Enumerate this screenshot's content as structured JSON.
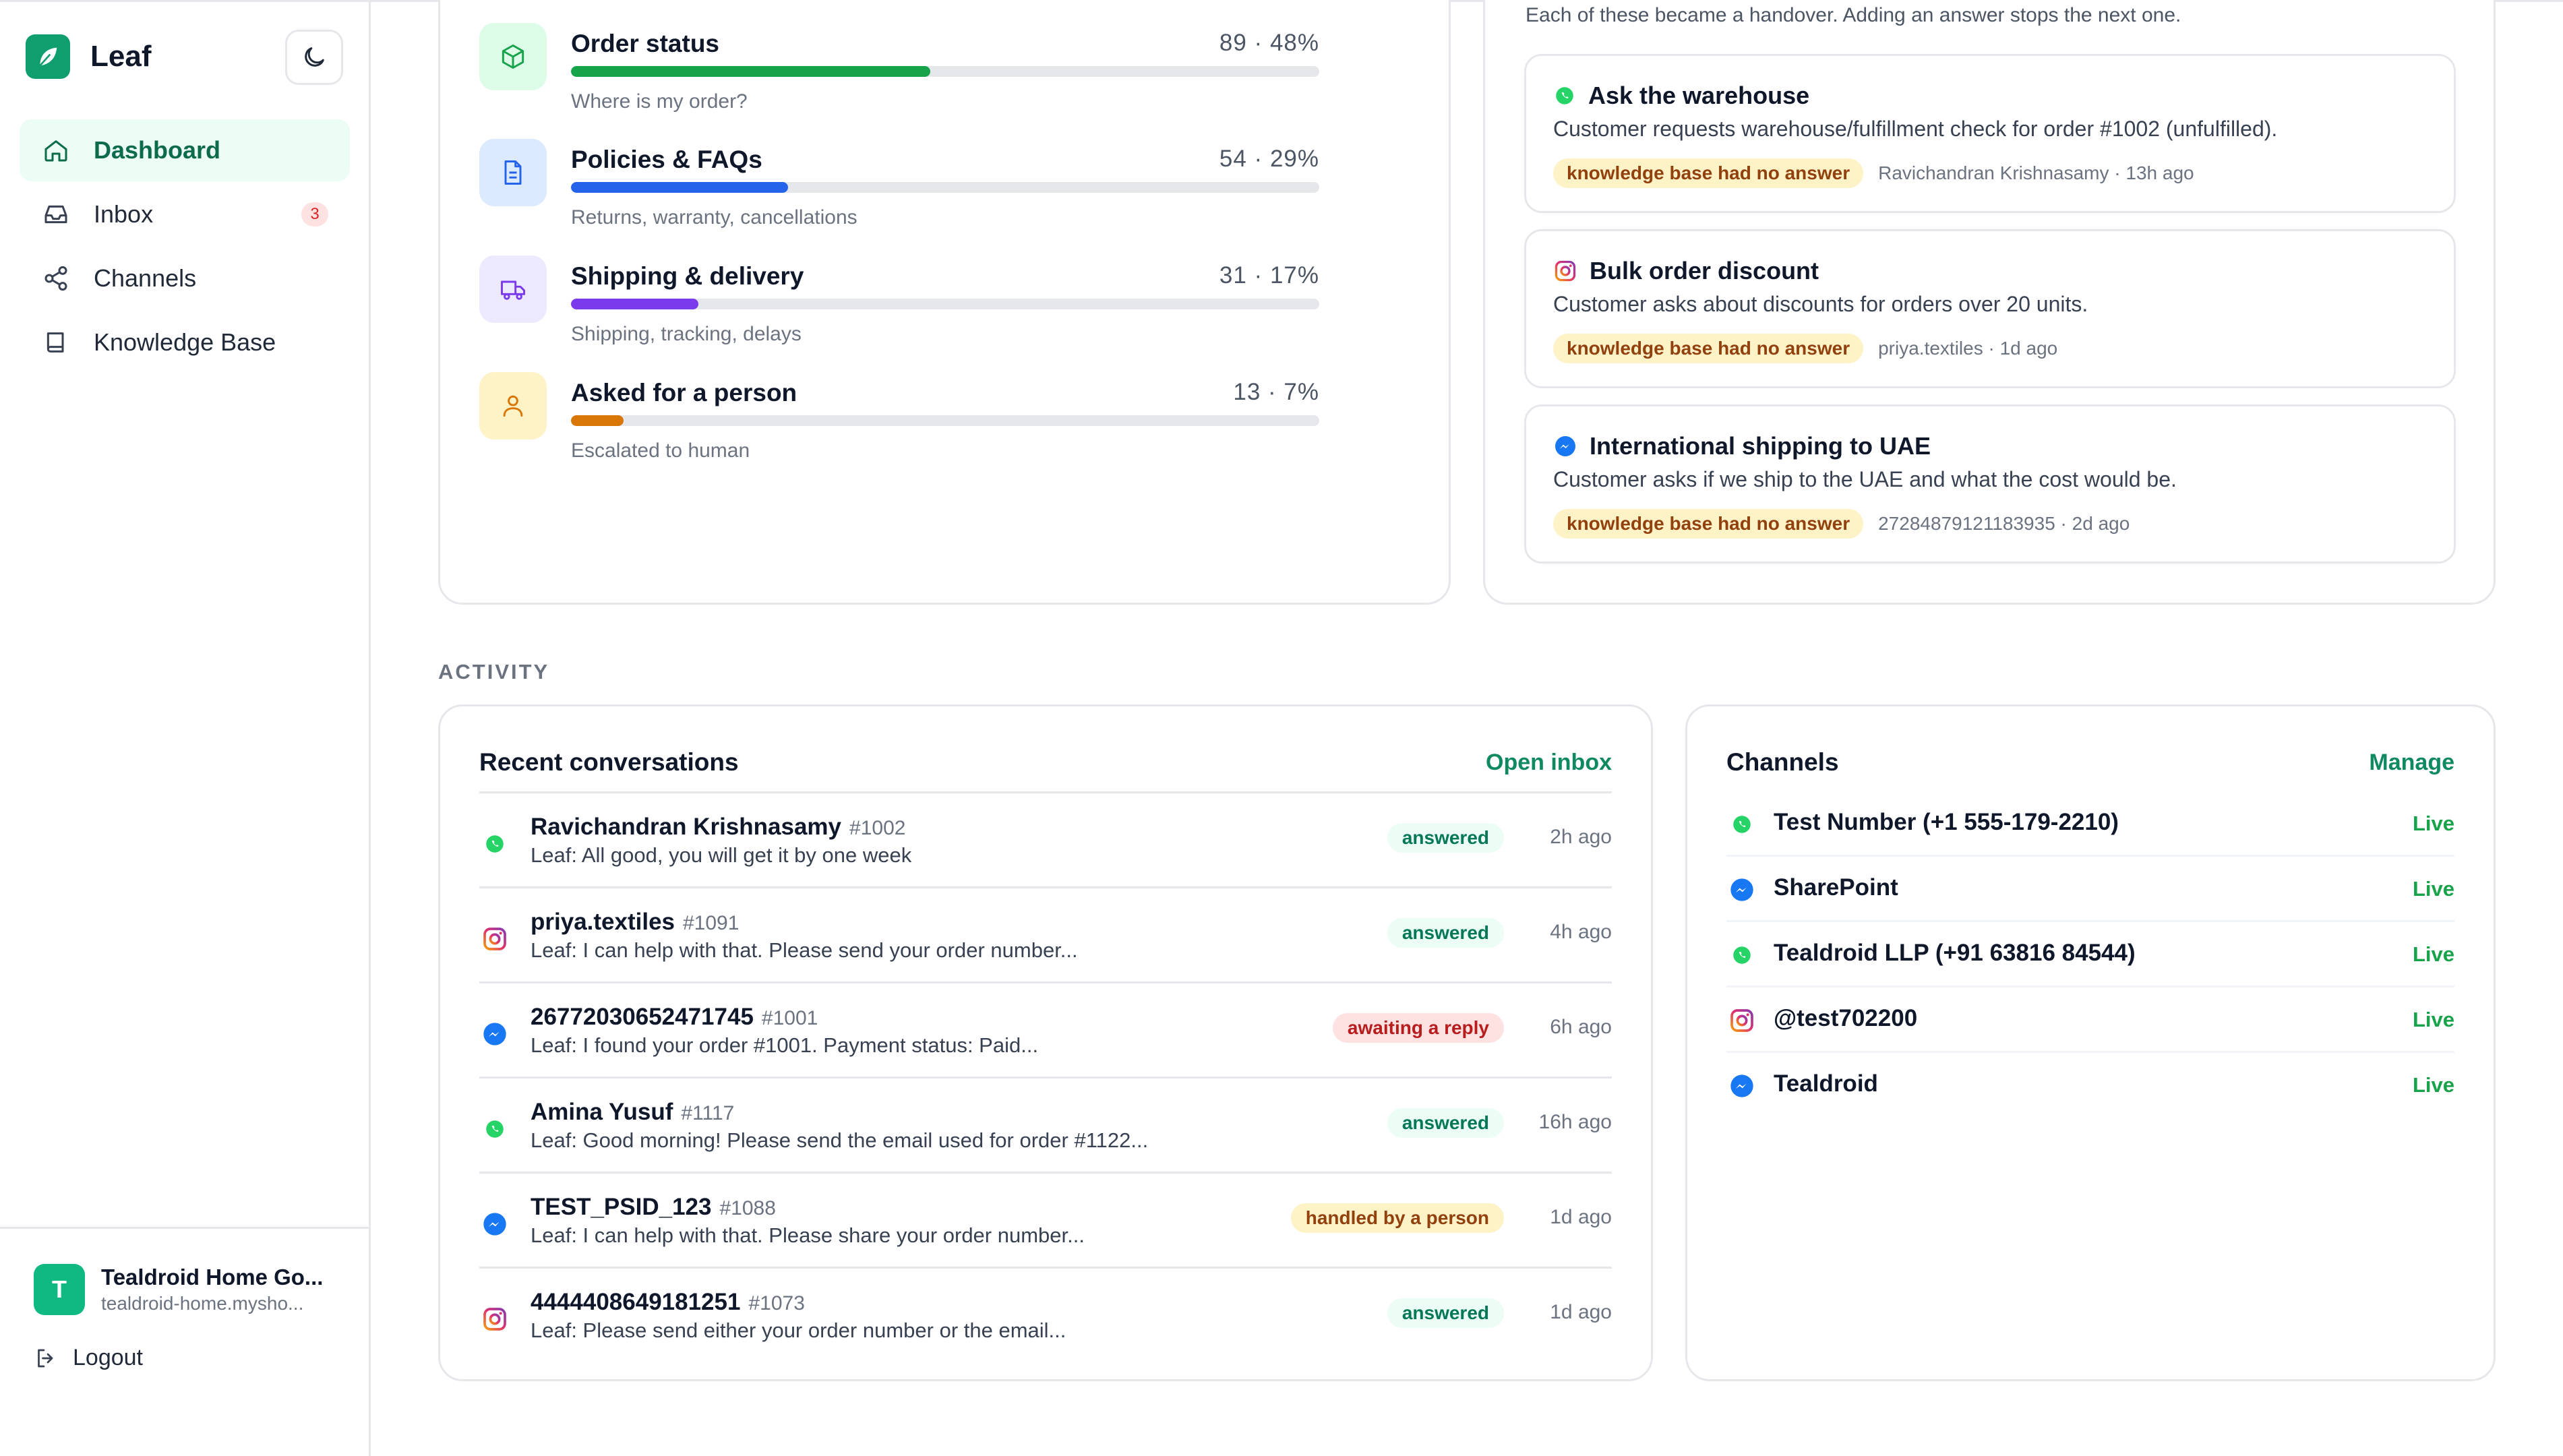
{
  "app": {
    "name": "Leaf",
    "accent": "#0f9f6e"
  },
  "sidebar": {
    "theme_toggle_icon": "moon-icon",
    "items": [
      {
        "label": "Dashboard",
        "icon": "home-icon",
        "active": true
      },
      {
        "label": "Inbox",
        "icon": "inbox-icon",
        "badge": "3"
      },
      {
        "label": "Channels",
        "icon": "share-icon"
      },
      {
        "label": "Knowledge Base",
        "icon": "book-icon"
      }
    ],
    "account": {
      "initial": "T",
      "name": "Tealdroid Home Go...",
      "domain": "tealdroid-home.mysho..."
    },
    "logout_label": "Logout"
  },
  "topics": [
    {
      "title": "Order status",
      "count": "89 · 48%",
      "fraction": 0.48,
      "subtitle": "Where is my order?",
      "color": "#16a34a",
      "bg": "#dcfce7",
      "icon": "box-icon"
    },
    {
      "title": "Policies & FAQs",
      "count": "54 · 29%",
      "fraction": 0.29,
      "subtitle": "Returns, warranty, cancellations",
      "color": "#2563eb",
      "bg": "#dbeafe",
      "icon": "document-icon"
    },
    {
      "title": "Shipping & delivery",
      "count": "31 · 17%",
      "fraction": 0.17,
      "subtitle": "Shipping, tracking, delays",
      "color": "#7c3aed",
      "bg": "#ede9fe",
      "icon": "truck-icon"
    },
    {
      "title": "Asked for a person",
      "count": "13 · 7%",
      "fraction": 0.07,
      "subtitle": "Escalated to human",
      "color": "#d97706",
      "bg": "#fef3c7",
      "icon": "person-icon"
    }
  ],
  "handovers": {
    "intro": "Each of these became a handover. Adding an answer stops the next one.",
    "items": [
      {
        "channel": "whatsapp",
        "title": "Ask the warehouse",
        "description": "Customer requests warehouse/fulfillment check for order #1002 (unfulfilled).",
        "tag": "knowledge base had no answer",
        "meta": "Ravichandran Krishnasamy · 13h ago"
      },
      {
        "channel": "instagram",
        "title": "Bulk order discount",
        "description": "Customer asks about discounts for orders over 20 units.",
        "tag": "knowledge base had no answer",
        "meta": "priya.textiles · 1d ago"
      },
      {
        "channel": "messenger",
        "title": "International shipping to UAE",
        "description": "Customer asks if we ship to the UAE and what the cost would be.",
        "tag": "knowledge base had no answer",
        "meta": "27284879121183935 · 2d ago"
      }
    ]
  },
  "activity": {
    "section_label": "ACTIVITY",
    "recent": {
      "title": "Recent conversations",
      "link": "Open inbox",
      "rows": [
        {
          "channel": "whatsapp",
          "name": "Ravichandran Krishnasamy",
          "order": "#1002",
          "preview": "Leaf: All good, you will get it by one week",
          "status": "answered",
          "status_kind": "answered",
          "time": "2h ago"
        },
        {
          "channel": "instagram",
          "name": "priya.textiles",
          "order": "#1091",
          "preview": "Leaf: I can help with that. Please send your order number...",
          "status": "answered",
          "status_kind": "answered",
          "time": "4h ago"
        },
        {
          "channel": "messenger",
          "name": "26772030652471745",
          "order": "#1001",
          "preview": "Leaf: I found your order #1001. Payment status: Paid...",
          "status": "awaiting a reply",
          "status_kind": "awaiting",
          "time": "6h ago"
        },
        {
          "channel": "whatsapp",
          "name": "Amina Yusuf",
          "order": "#1117",
          "preview": "Leaf: Good morning! Please send the email used for order #1122...",
          "status": "answered",
          "status_kind": "answered",
          "time": "16h ago"
        },
        {
          "channel": "messenger",
          "name": "TEST_PSID_123",
          "order": "#1088",
          "preview": "Leaf: I can help with that. Please share your order number...",
          "status": "handled by a person",
          "status_kind": "handled",
          "time": "1d ago"
        },
        {
          "channel": "instagram",
          "name": "4444408649181251",
          "order": "#1073",
          "preview": "Leaf: Please send either your order number or the email...",
          "status": "answered",
          "status_kind": "answered",
          "time": "1d ago"
        }
      ]
    },
    "channels": {
      "title": "Channels",
      "link": "Manage",
      "rows": [
        {
          "channel": "whatsapp",
          "name": "Test Number (+1 555-179-2210)",
          "status": "Live"
        },
        {
          "channel": "messenger",
          "name": "SharePoint",
          "status": "Live"
        },
        {
          "channel": "whatsapp",
          "name": "Tealdroid LLP (+91 63816 84544)",
          "status": "Live"
        },
        {
          "channel": "instagram",
          "name": "@test702200",
          "status": "Live"
        },
        {
          "channel": "messenger",
          "name": "Tealdroid",
          "status": "Live"
        }
      ]
    }
  }
}
